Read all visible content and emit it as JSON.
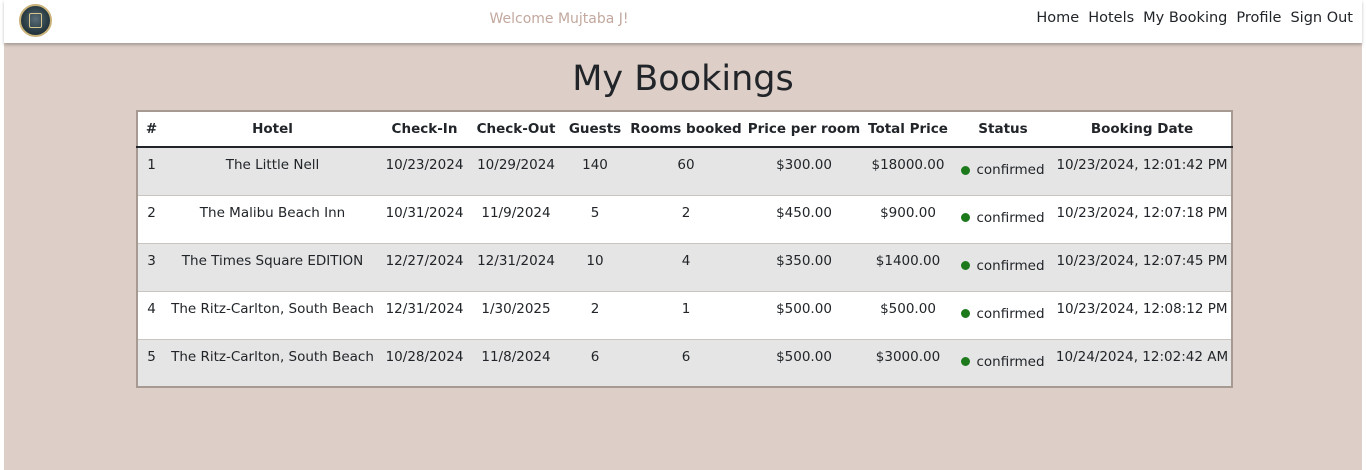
{
  "nav": {
    "welcome": "Welcome Mujtaba J!",
    "links": [
      "Home",
      "Hotels",
      "My Booking",
      "Profile",
      "Sign Out"
    ]
  },
  "page": {
    "title": "My Bookings"
  },
  "table": {
    "headers": [
      "#",
      "Hotel",
      "Check-In",
      "Check-Out",
      "Guests",
      "Rooms booked",
      "Price per room",
      "Total Price",
      "Status",
      "Booking Date"
    ],
    "rows": [
      [
        "1",
        "The Little Nell",
        "10/23/2024",
        "10/29/2024",
        "140",
        "60",
        "$300.00",
        "$18000.00",
        "confirmed",
        "10/23/2024, 12:01:42 PM"
      ],
      [
        "2",
        "The Malibu Beach Inn",
        "10/31/2024",
        "11/9/2024",
        "5",
        "2",
        "$450.00",
        "$900.00",
        "confirmed",
        "10/23/2024, 12:07:18 PM"
      ],
      [
        "3",
        "The Times Square EDITION",
        "12/27/2024",
        "12/31/2024",
        "10",
        "4",
        "$350.00",
        "$1400.00",
        "confirmed",
        "10/23/2024, 12:07:45 PM"
      ],
      [
        "4",
        "The Ritz-Carlton, South Beach",
        "12/31/2024",
        "1/30/2025",
        "2",
        "1",
        "$500.00",
        "$500.00",
        "confirmed",
        "10/23/2024, 12:08:12 PM"
      ],
      [
        "5",
        "The Ritz-Carlton, South Beach",
        "10/28/2024",
        "11/8/2024",
        "6",
        "6",
        "$500.00",
        "$3000.00",
        "confirmed",
        "10/24/2024, 12:02:42 AM"
      ]
    ]
  },
  "colors": {
    "background": "#ddcfc7",
    "status_confirmed": "#1c7a1c",
    "welcome_text": "#c2a89e",
    "row_alt": "#e5e5e5"
  },
  "icons": {
    "logo": "hotel-crest-logo"
  }
}
